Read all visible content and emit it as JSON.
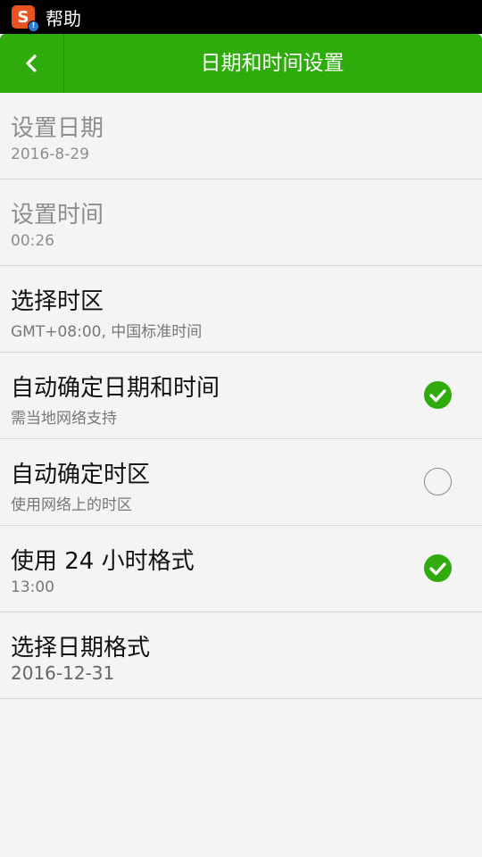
{
  "status_bar": {
    "app_label": "帮助"
  },
  "header": {
    "title": "日期和时间设置"
  },
  "settings": [
    {
      "title": "设置日期",
      "subtitle": "2016-8-29"
    },
    {
      "title": "设置时间",
      "subtitle": "00:26"
    },
    {
      "title": "选择时区",
      "subtitle": "GMT+08:00, 中国标准时间"
    },
    {
      "title": "自动确定日期和时间",
      "subtitle": "需当地网络支持",
      "checked": true
    },
    {
      "title": "自动确定时区",
      "subtitle": "使用网络上的时区",
      "checked": false
    },
    {
      "title": "使用 24 小时格式",
      "subtitle": "13:00",
      "checked": true
    },
    {
      "title": "选择日期格式",
      "subtitle": "2016-12-31"
    }
  ],
  "colors": {
    "accent": "#2fab0c",
    "background": "#f4f4f4"
  }
}
